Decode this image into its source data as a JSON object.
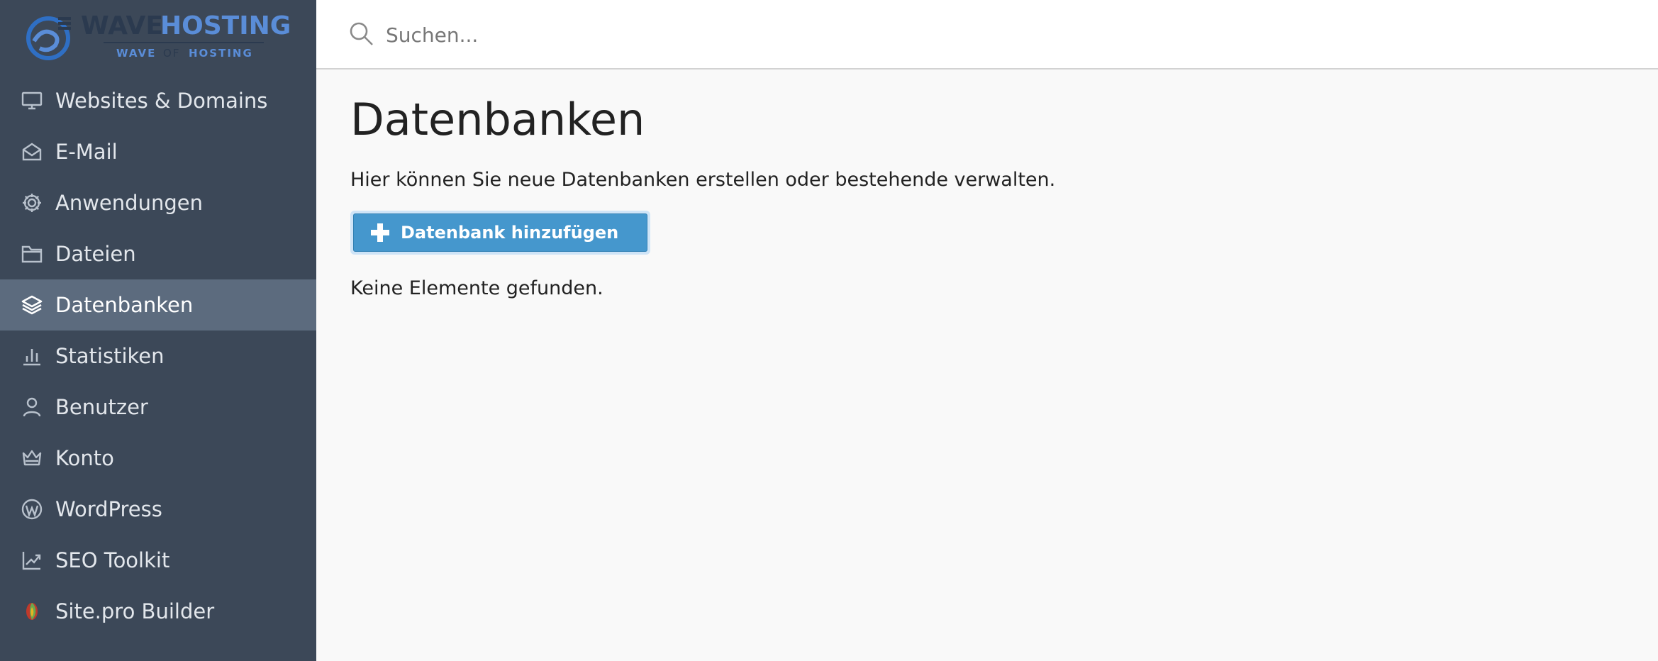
{
  "brand": {
    "logo_word_1": "WAVE",
    "logo_word_2": "HOSTING",
    "logo_tagline_1": "WAVE",
    "logo_tagline_2": "OF",
    "logo_tagline_3": "HOSTING"
  },
  "colors": {
    "sidebar_bg": "#3c4858",
    "sidebar_active_bg": "#5c6b7e",
    "button_bg": "#4597cd",
    "logo_dark": "#2b3a4f",
    "logo_blue": "#5a8dd8"
  },
  "search": {
    "placeholder": "Suchen..."
  },
  "sidebar": {
    "items": [
      {
        "label": "Websites & Domains",
        "icon": "monitor-icon",
        "active": false
      },
      {
        "label": "E-Mail",
        "icon": "envelope-icon",
        "active": false
      },
      {
        "label": "Anwendungen",
        "icon": "gear-icon",
        "active": false
      },
      {
        "label": "Dateien",
        "icon": "folder-icon",
        "active": false
      },
      {
        "label": "Datenbanken",
        "icon": "layers-icon",
        "active": true
      },
      {
        "label": "Statistiken",
        "icon": "bar-chart-icon",
        "active": false
      },
      {
        "label": "Benutzer",
        "icon": "user-icon",
        "active": false
      },
      {
        "label": "Konto",
        "icon": "crown-icon",
        "active": false
      },
      {
        "label": "WordPress",
        "icon": "wordpress-icon",
        "active": false
      },
      {
        "label": "SEO Toolkit",
        "icon": "trend-chart-icon",
        "active": false
      },
      {
        "label": "Site.pro Builder",
        "icon": "sitepro-icon",
        "active": false
      }
    ]
  },
  "main": {
    "title": "Datenbanken",
    "description": "Hier können Sie neue Datenbanken erstellen oder bestehende verwalten.",
    "add_button_label": "Datenbank hinzufügen",
    "empty_message": "Keine Elemente gefunden."
  }
}
